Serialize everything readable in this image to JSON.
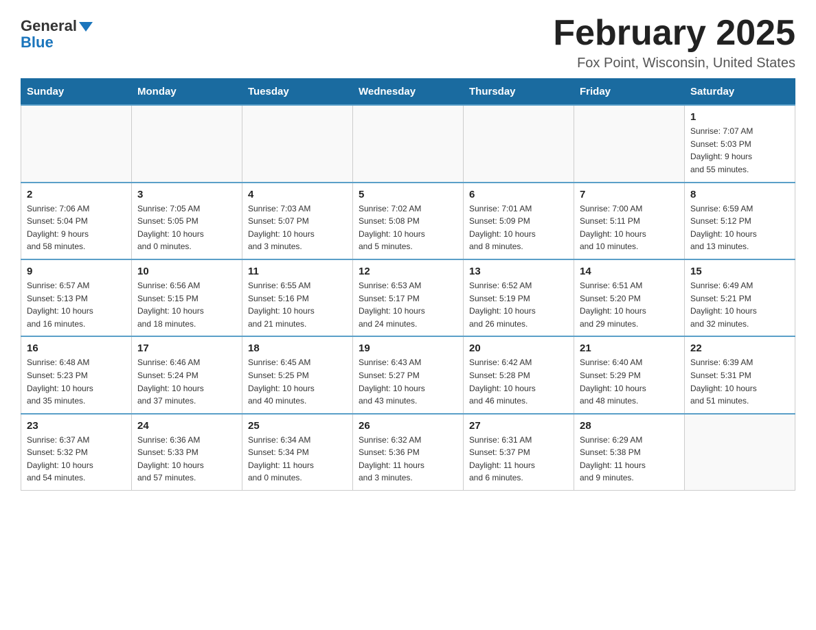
{
  "logo": {
    "general": "General",
    "blue": "Blue"
  },
  "header": {
    "month_title": "February 2025",
    "location": "Fox Point, Wisconsin, United States"
  },
  "days_of_week": [
    "Sunday",
    "Monday",
    "Tuesday",
    "Wednesday",
    "Thursday",
    "Friday",
    "Saturday"
  ],
  "weeks": [
    [
      {
        "day": "",
        "info": ""
      },
      {
        "day": "",
        "info": ""
      },
      {
        "day": "",
        "info": ""
      },
      {
        "day": "",
        "info": ""
      },
      {
        "day": "",
        "info": ""
      },
      {
        "day": "",
        "info": ""
      },
      {
        "day": "1",
        "info": "Sunrise: 7:07 AM\nSunset: 5:03 PM\nDaylight: 9 hours\nand 55 minutes."
      }
    ],
    [
      {
        "day": "2",
        "info": "Sunrise: 7:06 AM\nSunset: 5:04 PM\nDaylight: 9 hours\nand 58 minutes."
      },
      {
        "day": "3",
        "info": "Sunrise: 7:05 AM\nSunset: 5:05 PM\nDaylight: 10 hours\nand 0 minutes."
      },
      {
        "day": "4",
        "info": "Sunrise: 7:03 AM\nSunset: 5:07 PM\nDaylight: 10 hours\nand 3 minutes."
      },
      {
        "day": "5",
        "info": "Sunrise: 7:02 AM\nSunset: 5:08 PM\nDaylight: 10 hours\nand 5 minutes."
      },
      {
        "day": "6",
        "info": "Sunrise: 7:01 AM\nSunset: 5:09 PM\nDaylight: 10 hours\nand 8 minutes."
      },
      {
        "day": "7",
        "info": "Sunrise: 7:00 AM\nSunset: 5:11 PM\nDaylight: 10 hours\nand 10 minutes."
      },
      {
        "day": "8",
        "info": "Sunrise: 6:59 AM\nSunset: 5:12 PM\nDaylight: 10 hours\nand 13 minutes."
      }
    ],
    [
      {
        "day": "9",
        "info": "Sunrise: 6:57 AM\nSunset: 5:13 PM\nDaylight: 10 hours\nand 16 minutes."
      },
      {
        "day": "10",
        "info": "Sunrise: 6:56 AM\nSunset: 5:15 PM\nDaylight: 10 hours\nand 18 minutes."
      },
      {
        "day": "11",
        "info": "Sunrise: 6:55 AM\nSunset: 5:16 PM\nDaylight: 10 hours\nand 21 minutes."
      },
      {
        "day": "12",
        "info": "Sunrise: 6:53 AM\nSunset: 5:17 PM\nDaylight: 10 hours\nand 24 minutes."
      },
      {
        "day": "13",
        "info": "Sunrise: 6:52 AM\nSunset: 5:19 PM\nDaylight: 10 hours\nand 26 minutes."
      },
      {
        "day": "14",
        "info": "Sunrise: 6:51 AM\nSunset: 5:20 PM\nDaylight: 10 hours\nand 29 minutes."
      },
      {
        "day": "15",
        "info": "Sunrise: 6:49 AM\nSunset: 5:21 PM\nDaylight: 10 hours\nand 32 minutes."
      }
    ],
    [
      {
        "day": "16",
        "info": "Sunrise: 6:48 AM\nSunset: 5:23 PM\nDaylight: 10 hours\nand 35 minutes."
      },
      {
        "day": "17",
        "info": "Sunrise: 6:46 AM\nSunset: 5:24 PM\nDaylight: 10 hours\nand 37 minutes."
      },
      {
        "day": "18",
        "info": "Sunrise: 6:45 AM\nSunset: 5:25 PM\nDaylight: 10 hours\nand 40 minutes."
      },
      {
        "day": "19",
        "info": "Sunrise: 6:43 AM\nSunset: 5:27 PM\nDaylight: 10 hours\nand 43 minutes."
      },
      {
        "day": "20",
        "info": "Sunrise: 6:42 AM\nSunset: 5:28 PM\nDaylight: 10 hours\nand 46 minutes."
      },
      {
        "day": "21",
        "info": "Sunrise: 6:40 AM\nSunset: 5:29 PM\nDaylight: 10 hours\nand 48 minutes."
      },
      {
        "day": "22",
        "info": "Sunrise: 6:39 AM\nSunset: 5:31 PM\nDaylight: 10 hours\nand 51 minutes."
      }
    ],
    [
      {
        "day": "23",
        "info": "Sunrise: 6:37 AM\nSunset: 5:32 PM\nDaylight: 10 hours\nand 54 minutes."
      },
      {
        "day": "24",
        "info": "Sunrise: 6:36 AM\nSunset: 5:33 PM\nDaylight: 10 hours\nand 57 minutes."
      },
      {
        "day": "25",
        "info": "Sunrise: 6:34 AM\nSunset: 5:34 PM\nDaylight: 11 hours\nand 0 minutes."
      },
      {
        "day": "26",
        "info": "Sunrise: 6:32 AM\nSunset: 5:36 PM\nDaylight: 11 hours\nand 3 minutes."
      },
      {
        "day": "27",
        "info": "Sunrise: 6:31 AM\nSunset: 5:37 PM\nDaylight: 11 hours\nand 6 minutes."
      },
      {
        "day": "28",
        "info": "Sunrise: 6:29 AM\nSunset: 5:38 PM\nDaylight: 11 hours\nand 9 minutes."
      },
      {
        "day": "",
        "info": ""
      }
    ]
  ]
}
